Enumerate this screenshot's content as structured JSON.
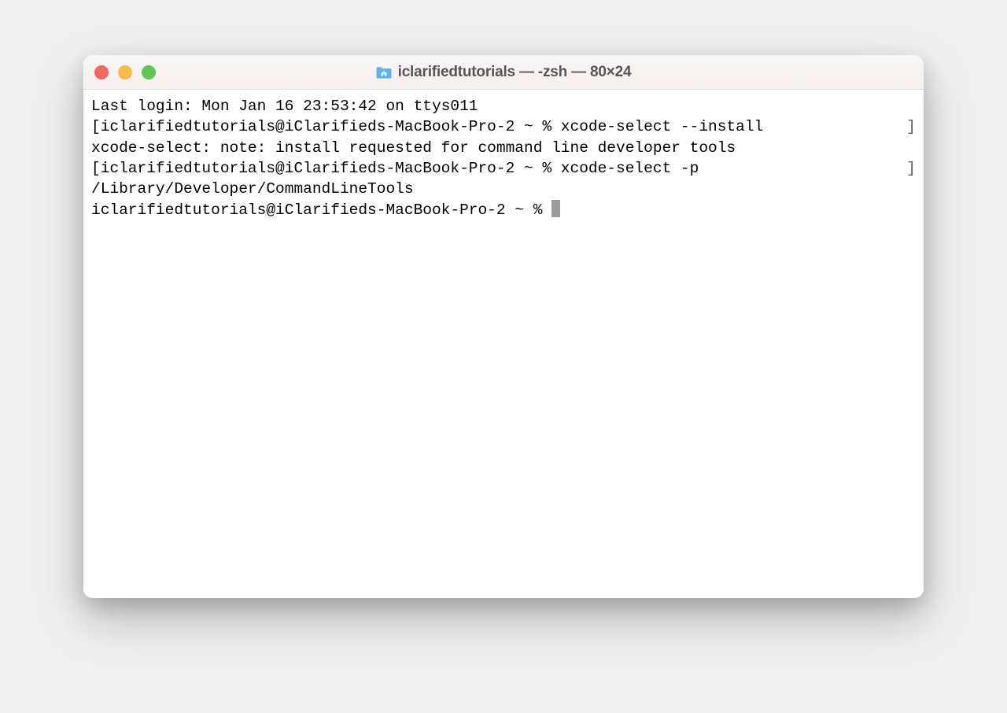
{
  "window": {
    "title": "iclarifiedtutorials — -zsh — 80×24",
    "icon": "home-folder-icon"
  },
  "terminal": {
    "lines": [
      {
        "left": "",
        "text": "Last login: Mon Jan 16 23:53:42 on ttys011",
        "right": ""
      },
      {
        "left": "[",
        "text": "iclarifiedtutorials@iClarifieds-MacBook-Pro-2 ~ % xcode-select --install",
        "right": "]"
      },
      {
        "left": "",
        "text": "xcode-select: note: install requested for command line developer tools",
        "right": ""
      },
      {
        "left": "[",
        "text": "iclarifiedtutorials@iClarifieds-MacBook-Pro-2 ~ % xcode-select -p",
        "right": "]"
      },
      {
        "left": "",
        "text": "/Library/Developer/CommandLineTools",
        "right": ""
      },
      {
        "left": "",
        "text": "iclarifiedtutorials@iClarifieds-MacBook-Pro-2 ~ % ",
        "right": "",
        "cursor": true
      }
    ]
  }
}
